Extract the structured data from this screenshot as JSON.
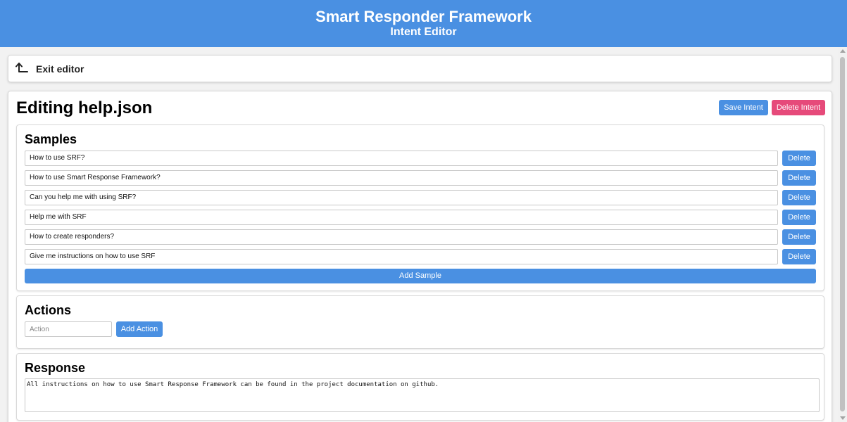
{
  "header": {
    "title": "Smart Responder Framework",
    "subtitle": "Intent Editor",
    "background": "#4a90e2"
  },
  "exit": {
    "icon": "return-arrow-icon",
    "label": "Exit editor"
  },
  "editor": {
    "title": "Editing help.json",
    "save_label": "Save Intent",
    "delete_label": "Delete Intent"
  },
  "samples": {
    "heading": "Samples",
    "items": [
      "How to use SRF?",
      "How to use Smart Response Framework?",
      "Can you help me with using SRF?",
      "Help me with SRF",
      "How to create responders?",
      "Give me instructions on how to use SRF"
    ],
    "delete_label": "Delete",
    "add_label": "Add Sample"
  },
  "actions": {
    "heading": "Actions",
    "input_placeholder": "Action",
    "add_label": "Add Action"
  },
  "response": {
    "heading": "Response",
    "text": "All instructions on how to use Smart Response Framework can be found in the project documentation on github."
  },
  "colors": {
    "primary": "#4a90e2",
    "danger": "#e64a7a"
  }
}
